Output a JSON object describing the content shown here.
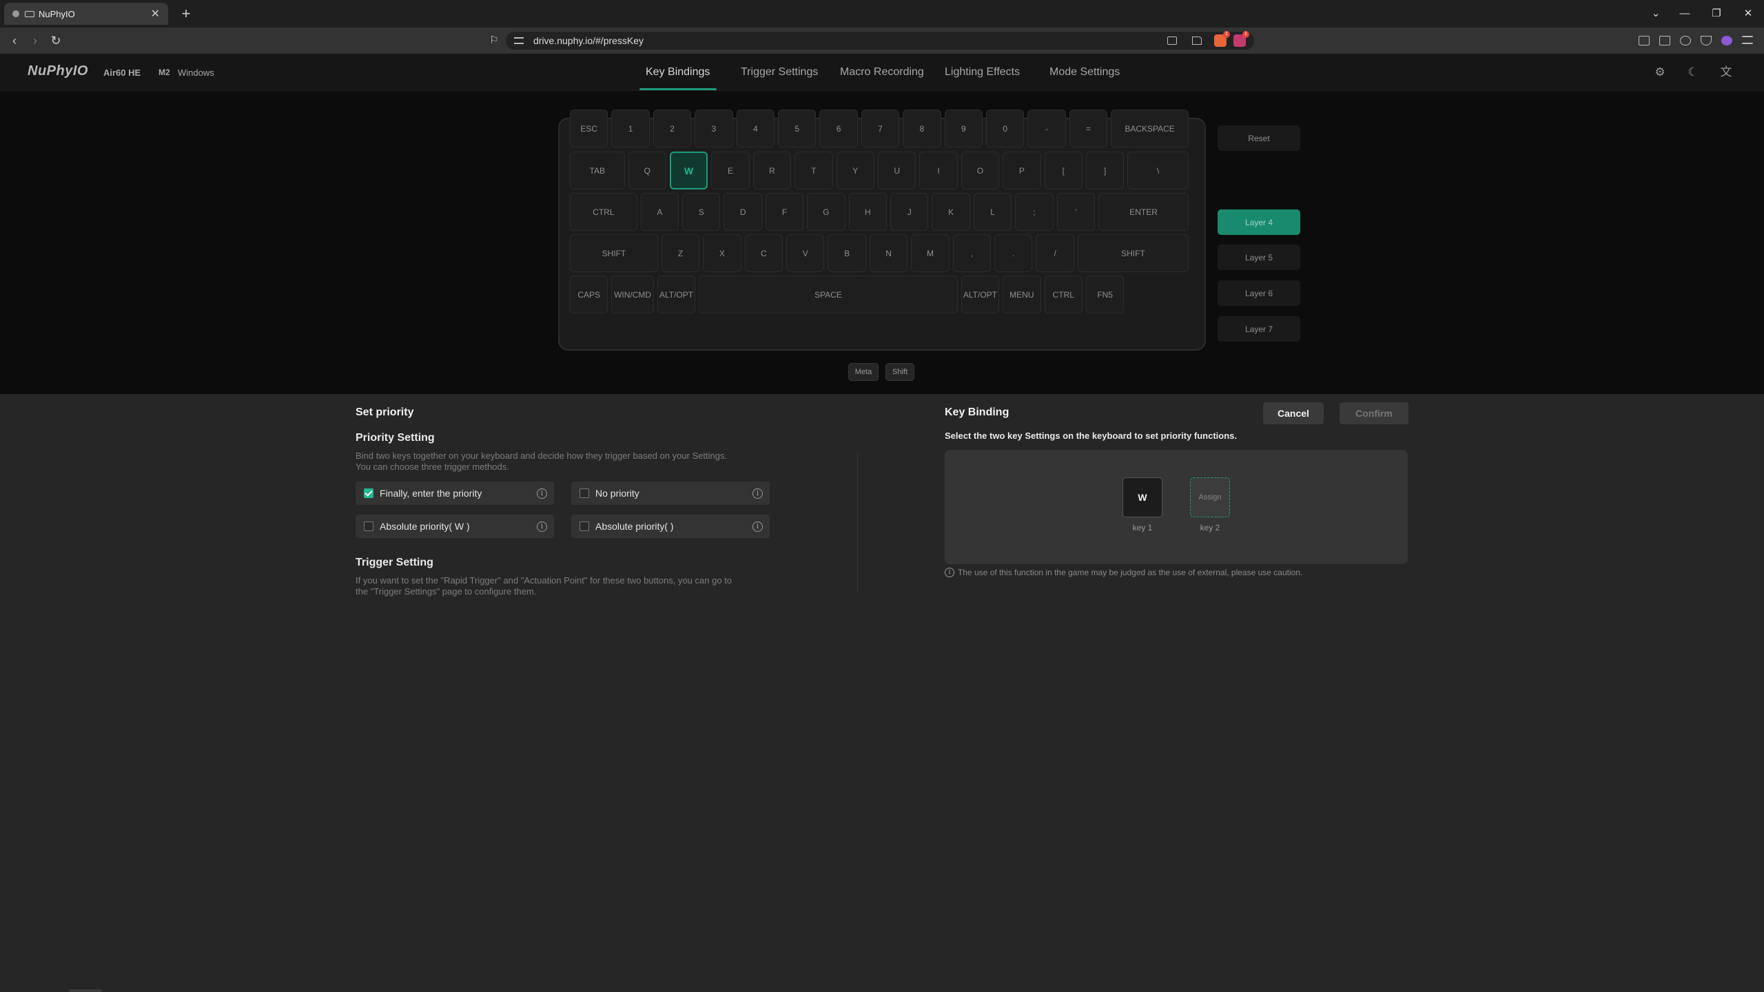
{
  "browser": {
    "tab_title": "NuPhyIO",
    "url": "drive.nuphy.io/#/pressKey",
    "new_tab": "+",
    "tab_close": "✕",
    "shield_badge": "1",
    "alert_badge": "1"
  },
  "header": {
    "logo": "NuPhyIO",
    "model": "Air60 HE",
    "mode": "M2",
    "os": "Windows",
    "tabs": [
      {
        "label": "Key Bindings"
      },
      {
        "label": "Trigger Settings"
      },
      {
        "label": "Macro Recording"
      },
      {
        "label": "Lighting Effects"
      },
      {
        "label": "Mode Settings"
      }
    ]
  },
  "keyboard": {
    "rows": [
      [
        "ESC",
        "1",
        "2",
        "3",
        "4",
        "5",
        "6",
        "7",
        "8",
        "9",
        "0",
        "-",
        "=",
        "BACKSPACE"
      ],
      [
        "TAB",
        "Q",
        "W",
        "E",
        "R",
        "T",
        "Y",
        "U",
        "I",
        "O",
        "P",
        "[",
        "]",
        "\\"
      ],
      [
        "CTRL",
        "A",
        "S",
        "D",
        "F",
        "G",
        "H",
        "J",
        "K",
        "L",
        ";",
        "'",
        "ENTER"
      ],
      [
        "SHIFT",
        "Z",
        "X",
        "C",
        "V",
        "B",
        "N",
        "M",
        ",",
        ".",
        "/",
        "SHIFT"
      ],
      [
        "CAPS",
        "WIN/CMD",
        "ALT/OPT",
        "SPACE",
        "ALT/OPT",
        "MENU",
        "CTRL",
        "FN5"
      ]
    ],
    "selected_key": "W",
    "modifiers": [
      "Meta",
      "Shift"
    ]
  },
  "side": {
    "reset": "Reset",
    "layers": [
      "Layer 4",
      "Layer 5",
      "Layer 6",
      "Layer 7"
    ],
    "active_layer": "Layer 4"
  },
  "priority": {
    "title": "Set priority",
    "setting_title": "Priority Setting",
    "desc_line1": "Bind two keys together on your keyboard and decide how they trigger based on your Settings.",
    "desc_line2": "You can choose three trigger methods.",
    "options": [
      {
        "label": "Finally, enter the priority",
        "checked": true
      },
      {
        "label": "No priority",
        "checked": false
      },
      {
        "label": "Absolute priority( W )",
        "checked": false
      },
      {
        "label": "Absolute priority( )",
        "checked": false
      }
    ],
    "trigger_title": "Trigger Setting",
    "trigger_line1": "If you want to set the \"Rapid Trigger\" and \"Actuation Point\" for these two buttons, you can go to",
    "trigger_line2": "the \"Trigger Settings\" page to configure them."
  },
  "binding": {
    "title": "Key Binding",
    "cancel": "Cancel",
    "confirm": "Confirm",
    "instruction": "Select the two key Settings on the keyboard to set priority functions.",
    "key1_value": "W",
    "key1_label": "key 1",
    "key2_value": "Assign",
    "key2_label": "key 2",
    "warning": "The use of this function in the game may be judged as the use of external, please use caution."
  },
  "colors": {
    "accent": "#1d9d7e",
    "background": "#252525",
    "keyboard_bg": "#0c0c0c"
  }
}
